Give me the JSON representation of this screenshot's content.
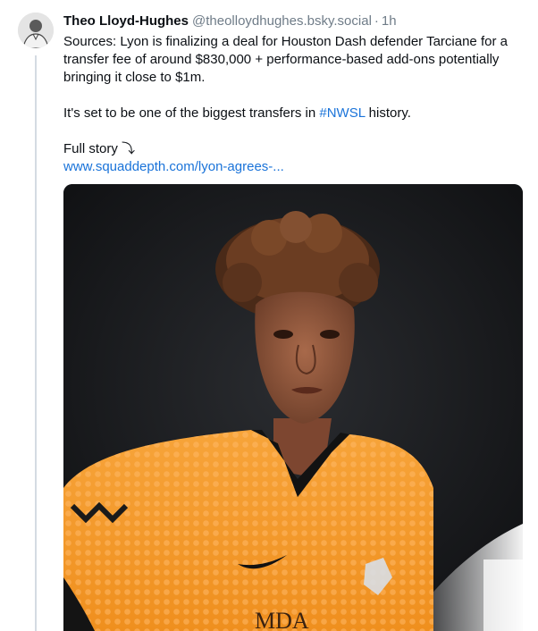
{
  "post": {
    "author": {
      "name": "Theo Lloyd-Hughes",
      "handle": "@theolloydhughes.bsky.social",
      "separator": "·",
      "time_ago": "1h"
    },
    "text": {
      "paragraph1": "Sources: Lyon is finalizing a deal for Houston Dash defender Tarciane for a transfer fee of around $830,000 + performance-based add-ons potentially bringing it close to $1m.",
      "paragraph2_before": "It's set to be one of the biggest transfers in ",
      "hashtag": "#NWSL",
      "paragraph2_after": " history.",
      "full_story_label": "Full story ⤵",
      "link_text": "www.squaddepth.com/lyon-agrees-..."
    },
    "media": {
      "icon": "photo-player-image",
      "jersey_lettering": "MDA"
    }
  },
  "colors": {
    "link": "#1a73d9",
    "muted": "#6f7c88",
    "jersey_orange": "#f39a2a",
    "background_dark": "#1a1c20"
  }
}
